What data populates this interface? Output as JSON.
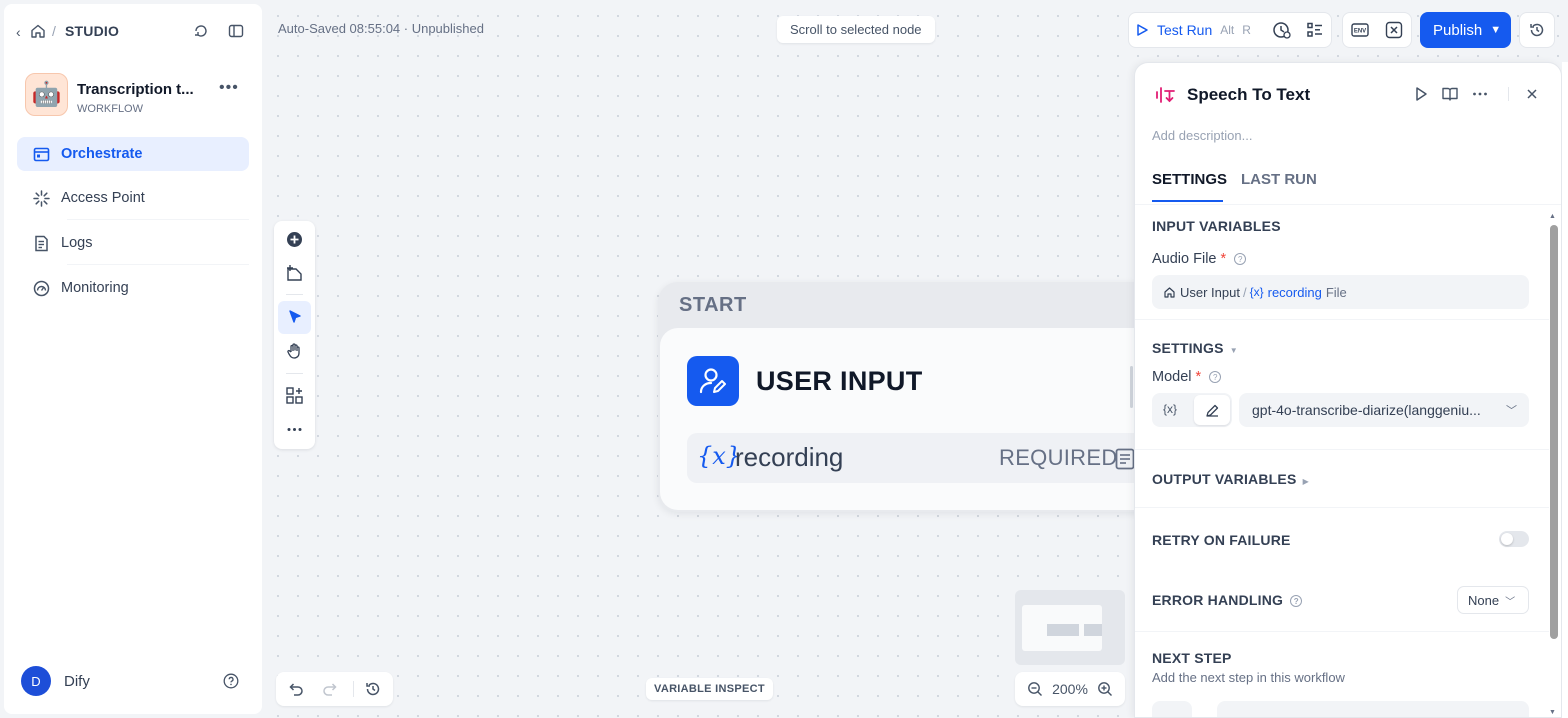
{
  "sidebar": {
    "breadcrumb": {
      "studio": "STUDIO"
    },
    "app": {
      "name": "Transcription t...",
      "type": "WORKFLOW",
      "avatar": "🤖"
    },
    "nav": [
      {
        "label": "Orchestrate",
        "icon": "orchestrate-icon",
        "active": true
      },
      {
        "label": "Access Point",
        "icon": "access-point-icon",
        "active": false
      },
      {
        "label": "Logs",
        "icon": "logs-icon",
        "active": false
      },
      {
        "label": "Monitoring",
        "icon": "monitoring-icon",
        "active": false
      }
    ],
    "user": {
      "initial": "D",
      "name": "Dify"
    }
  },
  "canvas": {
    "autosave": "Auto-Saved 08:55:04 · Unpublished",
    "scroll_to_selected": "Scroll to selected node",
    "variable_inspect": "VARIABLE INSPECT",
    "zoom": "200%"
  },
  "toolbar": {
    "test_run": "Test Run",
    "shortcut_alt": "Alt",
    "shortcut_key": "R",
    "publish": "Publish"
  },
  "start_node": {
    "label": "START",
    "title": "USER INPUT",
    "variable_icon": "{x}",
    "variable": "recording",
    "required": "REQUIRED"
  },
  "panel": {
    "title": "Speech To Text",
    "description_placeholder": "Add description...",
    "tabs": [
      {
        "label": "SETTINGS",
        "active": true
      },
      {
        "label": "LAST RUN",
        "active": false
      }
    ],
    "input_variables": {
      "heading": "INPUT VARIABLES",
      "audio_label": "Audio File",
      "required_mark": "*",
      "source": "User Input",
      "separator": "/",
      "var_icon": "{x}",
      "var_name": "recording",
      "var_type": "File"
    },
    "settings": {
      "heading": "SETTINGS",
      "model_label": "Model",
      "required_mark": "*",
      "var_icon": "{x}",
      "model_value": "gpt-4o-transcribe-diarize(langgeniu..."
    },
    "output_variables": {
      "heading": "OUTPUT VARIABLES"
    },
    "retry": {
      "heading": "RETRY ON FAILURE",
      "enabled": false
    },
    "error_handling": {
      "heading": "ERROR HANDLING",
      "value": "None"
    },
    "next_step": {
      "heading": "NEXT STEP",
      "description": "Add the next step in this workflow"
    }
  },
  "colors": {
    "accent": "#155aef",
    "nav_active_bg": "#e8efff",
    "required": "#f04438",
    "node_icon_bg": "#155aef"
  }
}
